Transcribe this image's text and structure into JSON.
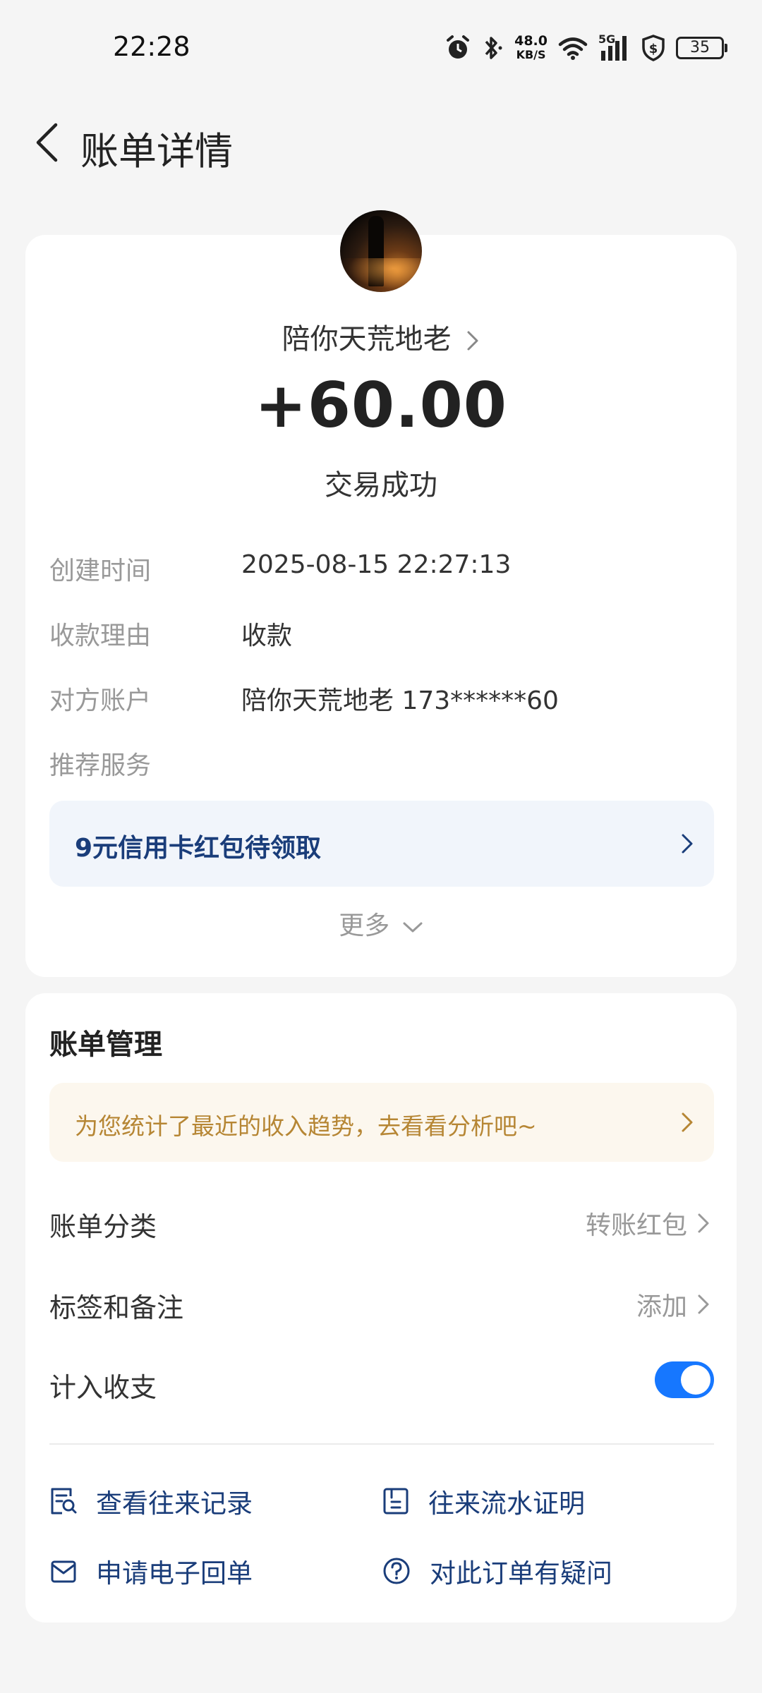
{
  "status_bar": {
    "time": "22:28",
    "net_speed_value": "48.0",
    "net_speed_unit": "KB/S",
    "network": "5G",
    "battery": "35",
    "icons": [
      "alarm-icon",
      "bluetooth-icon",
      "wifi-icon",
      "signal-icon",
      "shield-icon",
      "battery-icon"
    ]
  },
  "header": {
    "title": "账单详情",
    "back_icon": "back-icon"
  },
  "transaction": {
    "payer_name": "陪你天荒地老",
    "amount": "+60.00",
    "status": "交易成功",
    "details": [
      {
        "label": "创建时间",
        "value": "2025-08-15 22:27:13"
      },
      {
        "label": "收款理由",
        "value": "收款"
      },
      {
        "label": "对方账户",
        "value": "陪你天荒地老 173******60"
      },
      {
        "label": "推荐服务",
        "value": ""
      }
    ],
    "promo": "9元信用卡红包待领取",
    "more": "更多"
  },
  "management": {
    "title": "账单管理",
    "tip": "为您统计了最近的收入趋势，去看看分析吧~",
    "rows": [
      {
        "label": "账单分类",
        "value": "转账红包"
      },
      {
        "label": "标签和备注",
        "value": "添加"
      },
      {
        "label": "计入收支",
        "toggle_on": true
      }
    ],
    "links": [
      {
        "label": "查看往来记录",
        "icon": "records-search-icon"
      },
      {
        "label": "往来流水证明",
        "icon": "statement-icon"
      },
      {
        "label": "申请电子回单",
        "icon": "mail-icon"
      },
      {
        "label": "对此订单有疑问",
        "icon": "question-icon"
      }
    ]
  },
  "colors": {
    "background": "#f5f5f5",
    "accent": "#1677ff",
    "link_text": "#1a3d7a",
    "tip_text": "#b68634"
  }
}
